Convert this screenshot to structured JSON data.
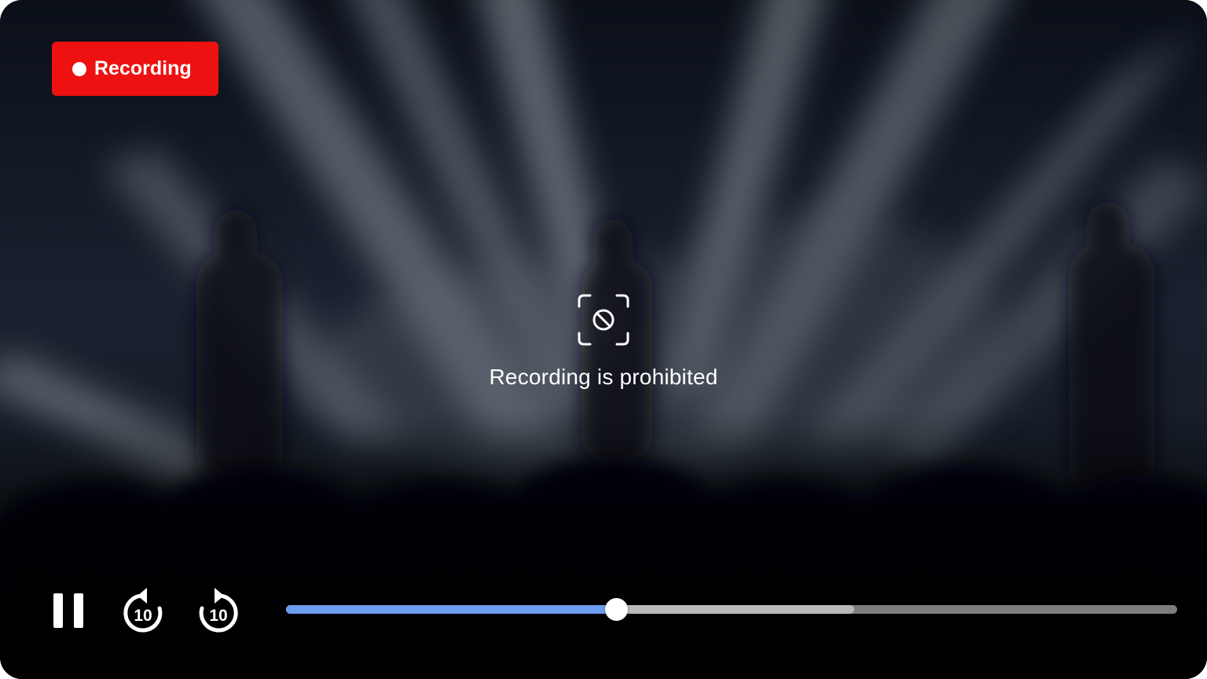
{
  "badge": {
    "label": "Recording",
    "color": "#ee1111"
  },
  "overlay": {
    "icon": "no-screenshot-icon",
    "message": "Recording is prohibited"
  },
  "controls": {
    "pause_icon": "pause-icon",
    "rewind": {
      "icon": "rewind-10-icon",
      "label": "10"
    },
    "forward": {
      "icon": "forward-10-icon",
      "label": "10"
    }
  },
  "progress": {
    "played_fraction": 0.37,
    "buffered_fraction": 0.638,
    "played_color": "#6b9df0",
    "buffered_color": "#b9b9b9",
    "track_color": "#7d7d7d"
  }
}
